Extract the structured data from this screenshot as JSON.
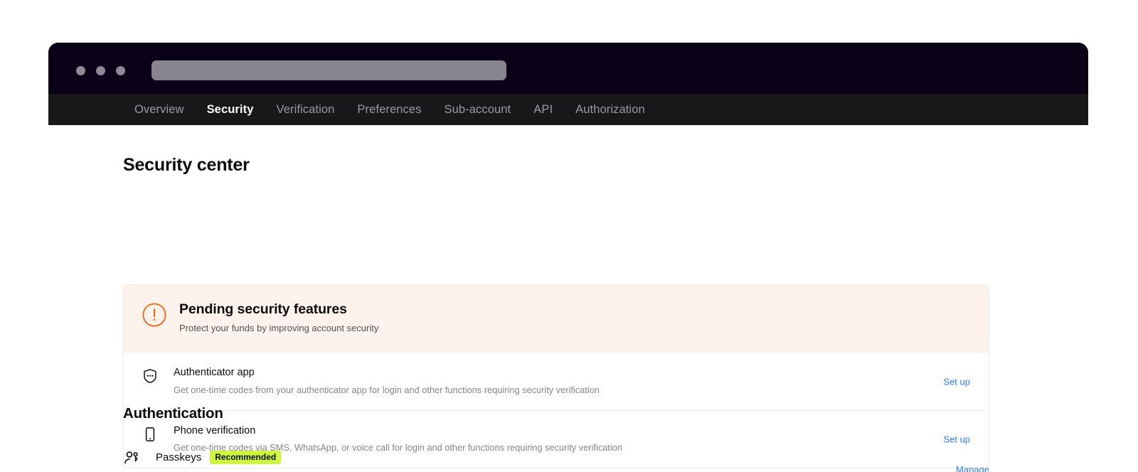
{
  "browser": {
    "traffic_lights": [
      "close",
      "minimize",
      "maximize"
    ],
    "url_value": "",
    "url_placeholder": ""
  },
  "nav": {
    "items": [
      {
        "label": "Overview",
        "active": false
      },
      {
        "label": "Security",
        "active": true
      },
      {
        "label": "Verification",
        "active": false
      },
      {
        "label": "Preferences",
        "active": false
      },
      {
        "label": "Sub-account",
        "active": false
      },
      {
        "label": "API",
        "active": false
      },
      {
        "label": "Authorization",
        "active": false
      }
    ]
  },
  "page": {
    "title": "Security center"
  },
  "pending_card": {
    "banner": {
      "icon": "alert-circle-icon",
      "title": "Pending security features",
      "subtitle": "Protect your funds by improving account security"
    },
    "rows": [
      {
        "icon": "shield-dots-icon",
        "title": "Authenticator app",
        "description": "Get one-time codes from your authenticator app for login and other functions requiring security verification",
        "action": "Set up"
      },
      {
        "icon": "mobile-phone-icon",
        "title": "Phone verification",
        "description": "Get one-time codes via SMS, WhatsApp, or voice call for login and other functions requiring security verification",
        "action": "Set up"
      }
    ]
  },
  "authentication": {
    "heading": "Authentication",
    "rows": [
      {
        "icon": "passkey-person-icon",
        "label": "Passkeys",
        "badge": "Recommended",
        "action": "Manage"
      }
    ]
  },
  "colors": {
    "titlebar": "#0a0318",
    "navbar": "#18181a",
    "nav_active_text": "#ffffff",
    "nav_text": "#9a9aa1",
    "url_bar": "#88858f",
    "banner_bg": "#fdf3ec",
    "alert_orange": "#f2691e",
    "link_blue": "#2d7cf6",
    "badge_lime": "#ccf73c",
    "text_primary": "#0b0b0d",
    "text_muted": "#86868c"
  }
}
